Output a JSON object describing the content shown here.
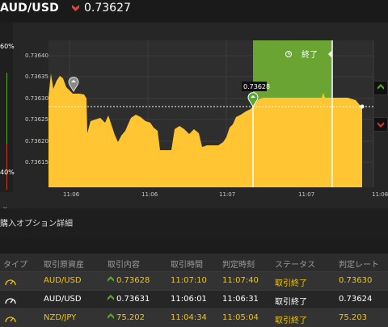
{
  "header": {
    "pair": "AUD/USD",
    "direction_icon": "down-arrow-icon",
    "rate": "0.73627",
    "down_color": "#e0433a"
  },
  "gauge": {
    "top_label": "60%",
    "bottom_label": "40%",
    "close_glyph": "×"
  },
  "chart": {
    "y_ticks": [
      "0.73640",
      "0.73635",
      "0.73630",
      "0.73625",
      "0.73620",
      "0.73615"
    ],
    "x_ticks": [
      "11:06",
      "11:06",
      "11:07",
      "11:07",
      "11:08"
    ],
    "current_price_tag": "0.73628",
    "end_label": "終了",
    "fill_color": "#ffc533",
    "period_color": "#6aa534",
    "call_color": "#5aa832",
    "put_color": "#d03a2a"
  },
  "section": {
    "title": "購入オプション詳細"
  },
  "table": {
    "headers": [
      "タイプ",
      "取引原資産",
      "取引内容",
      "取引時間",
      "判定時刻",
      "ステータス",
      "判定レート"
    ],
    "rows": [
      {
        "asset": "AUD/USD",
        "content": "0.73628",
        "trade_time": "11:07:10",
        "judge_time": "11:07:40",
        "status": "取引終了",
        "rate": "0.73630"
      },
      {
        "asset": "AUD/USD",
        "content": "0.73631",
        "trade_time": "11:06:01",
        "judge_time": "11:06:31",
        "status": "取引終了",
        "rate": "0.73624"
      },
      {
        "asset": "NZD/JPY",
        "content": "75.202",
        "trade_time": "11:04:34",
        "judge_time": "11:05:04",
        "status": "取引終了",
        "rate": "75.203"
      }
    ]
  }
}
